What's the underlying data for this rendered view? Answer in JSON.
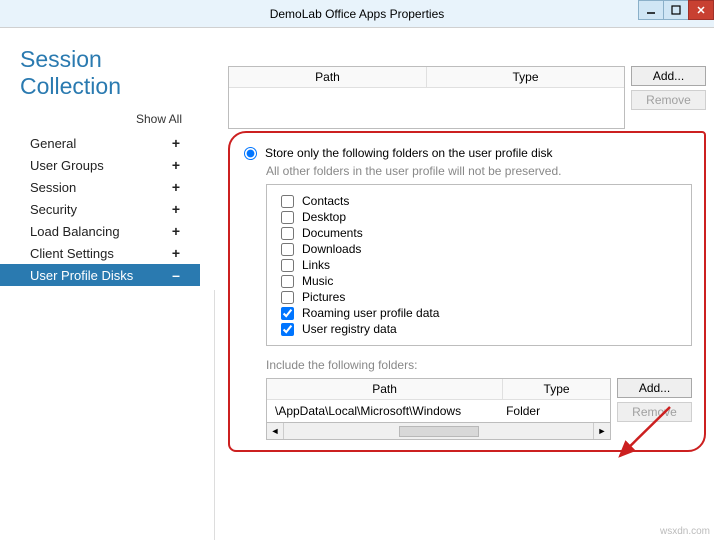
{
  "window": {
    "title": "DemoLab Office Apps Properties"
  },
  "page": {
    "heading": "Session Collection",
    "show_all": "Show All"
  },
  "nav": {
    "items": [
      {
        "label": "General",
        "expand": "+"
      },
      {
        "label": "User Groups",
        "expand": "+"
      },
      {
        "label": "Session",
        "expand": "+"
      },
      {
        "label": "Security",
        "expand": "+"
      },
      {
        "label": "Load Balancing",
        "expand": "+"
      },
      {
        "label": "Client Settings",
        "expand": "+"
      },
      {
        "label": "User Profile Disks",
        "expand": "–"
      }
    ],
    "selected_index": 6
  },
  "upper_grid": {
    "headers": [
      "Path",
      "Type"
    ]
  },
  "buttons": {
    "add": "Add...",
    "remove": "Remove"
  },
  "store_option": {
    "radio_label": "Store only the following folders on the user profile disk",
    "sub_label": "All other folders in the user profile will not be preserved.",
    "folders": [
      {
        "label": "Contacts",
        "checked": false
      },
      {
        "label": "Desktop",
        "checked": false
      },
      {
        "label": "Documents",
        "checked": false
      },
      {
        "label": "Downloads",
        "checked": false
      },
      {
        "label": "Links",
        "checked": false
      },
      {
        "label": "Music",
        "checked": false
      },
      {
        "label": "Pictures",
        "checked": false
      },
      {
        "label": "Roaming user profile data",
        "checked": true
      },
      {
        "label": "User registry data",
        "checked": true
      }
    ]
  },
  "include": {
    "label": "Include the following folders:",
    "headers": [
      "Path",
      "Type"
    ],
    "rows": [
      {
        "path": "\\AppData\\Local\\Microsoft\\Windows",
        "type": "Folder"
      }
    ]
  },
  "watermark": "wsxdn.com"
}
